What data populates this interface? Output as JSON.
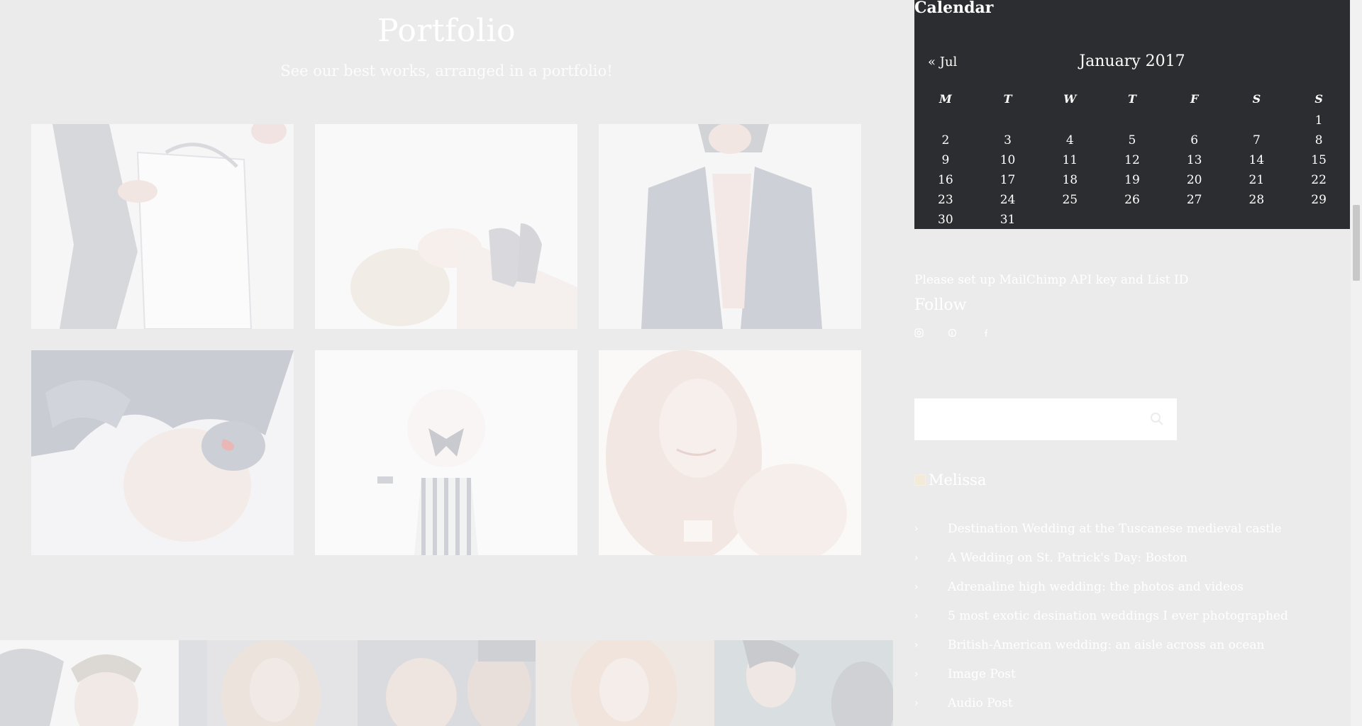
{
  "portfolio": {
    "title": "Portfolio",
    "subtitle": "See our best works, arranged in a portfolio!"
  },
  "grid_images": [
    {
      "label": "bag-photo"
    },
    {
      "label": "reclining-photo"
    },
    {
      "label": "blazer-photo"
    },
    {
      "label": "feathers-photo"
    },
    {
      "label": "striped-dress-photo"
    },
    {
      "label": "curly-hair-photo"
    }
  ],
  "calendar": {
    "heading": "Calendar",
    "prev": "« Jul",
    "month": "January 2017",
    "weekdays": [
      "M",
      "T",
      "W",
      "T",
      "F",
      "S",
      "S"
    ],
    "weeks": [
      [
        "",
        "",
        "",
        "",
        "",
        "",
        "1"
      ],
      [
        "2",
        "3",
        "4",
        "5",
        "6",
        "7",
        "8"
      ],
      [
        "9",
        "10",
        "11",
        "12",
        "13",
        "14",
        "15"
      ],
      [
        "16",
        "17",
        "18",
        "19",
        "20",
        "21",
        "22"
      ],
      [
        "23",
        "24",
        "25",
        "26",
        "27",
        "28",
        "29"
      ],
      [
        "30",
        "31",
        "",
        "",
        "",
        "",
        ""
      ]
    ]
  },
  "mailchimp_notice": "Please set up MailChimp API key and List ID",
  "follow": {
    "title": "Follow",
    "icons": [
      "instagram-icon",
      "pinterest-icon",
      "facebook-icon"
    ]
  },
  "search": {
    "placeholder": ""
  },
  "author": {
    "name": "Melissa"
  },
  "recent_posts": [
    "Destination Wedding at the Tuscanese medieval castle",
    "A Wedding on St. Patrick's Day: Boston",
    "Adrenaline high wedding: the photos and videos",
    "5 most exotic desination weddings I ever photographed",
    "British-American wedding: an aisle across an ocean",
    "Image Post",
    "Audio Post"
  ],
  "colors": {
    "page_bg": "#ebebeb",
    "calendar_bg": "#2c2d30",
    "text_light": "#ffffff"
  }
}
